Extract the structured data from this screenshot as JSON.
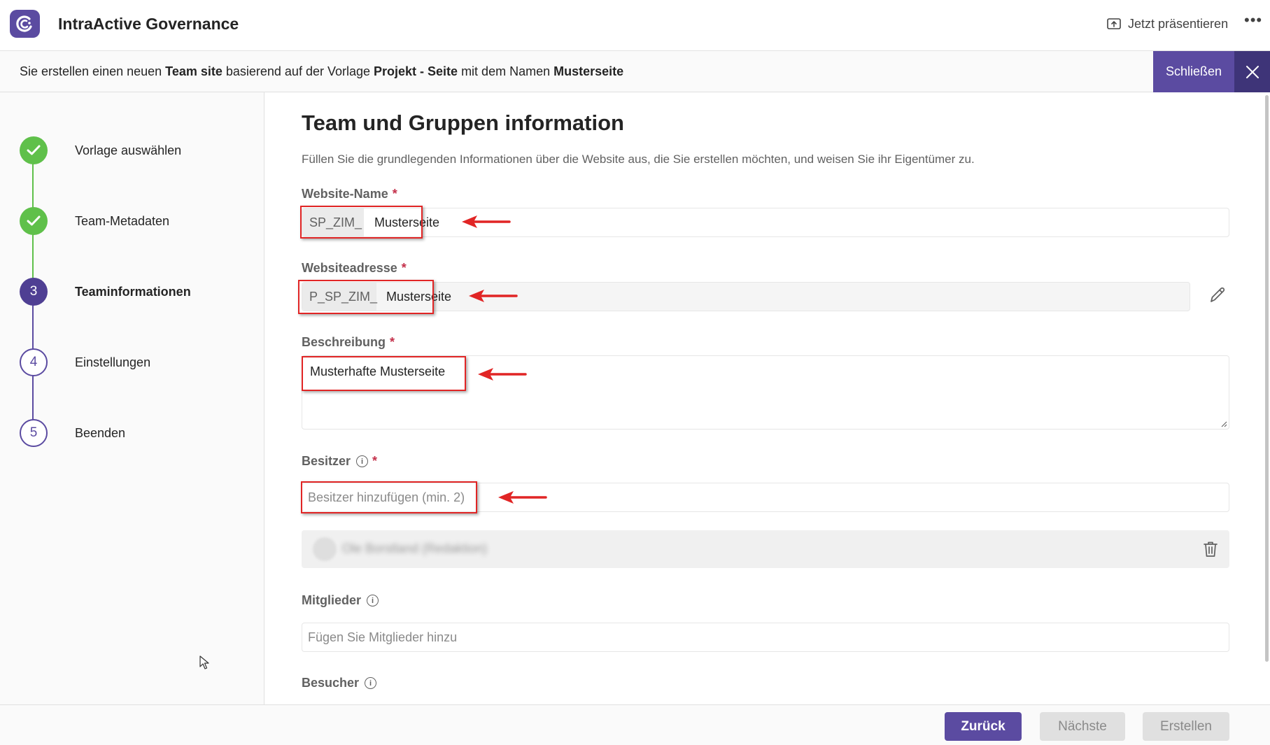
{
  "header": {
    "app_title": "IntraActive Governance",
    "present_label": "Jetzt präsentieren",
    "more_label": "•••"
  },
  "info_bar": {
    "t1": "Sie erstellen einen neuen ",
    "site_type": "Team site",
    "t2": " basierend auf der Vorlage ",
    "template": "Projekt - Seite",
    "t3": " mit dem Namen ",
    "name": "Musterseite",
    "close_label": "Schließen"
  },
  "steps": [
    {
      "number": "1",
      "label": "Vorlage auswählen",
      "state": "done"
    },
    {
      "number": "2",
      "label": "Team-Metadaten",
      "state": "done"
    },
    {
      "number": "3",
      "label": "Teaminformationen",
      "state": "current"
    },
    {
      "number": "4",
      "label": "Einstellungen",
      "state": "todo"
    },
    {
      "number": "5",
      "label": "Beenden",
      "state": "todo"
    }
  ],
  "form": {
    "title": "Team und Gruppen information",
    "description": "Füllen Sie die grundlegenden Informationen über die Website aus, die Sie erstellen möchten, und weisen Sie ihr Eigentümer zu.",
    "required_marker": "*",
    "info_glyph": "i",
    "website_name": {
      "label": "Website-Name",
      "prefix": "SP_ZIM_",
      "value": "Musterseite"
    },
    "website_address": {
      "label": "Websiteadresse",
      "prefix": "P_SP_ZIM_",
      "value": "Musterseite"
    },
    "description_field": {
      "label": "Beschreibung",
      "value": "Musterhafte Musterseite"
    },
    "owners": {
      "label": "Besitzer",
      "placeholder": "Besitzer hinzufügen (min. 2)",
      "owner_name": "Ole Borstland (Redaktion)"
    },
    "members": {
      "label": "Mitglieder",
      "placeholder": "Fügen Sie Mitglieder hinzu"
    },
    "visitors": {
      "label": "Besucher"
    }
  },
  "footer": {
    "back_label": "Zurück",
    "next_label": "Nächste",
    "create_label": "Erstellen"
  },
  "colors": {
    "accent": "#5b4ba1",
    "accent_dark": "#3e3478",
    "step_done": "#5fc04a",
    "annotation_red": "#e12525"
  }
}
